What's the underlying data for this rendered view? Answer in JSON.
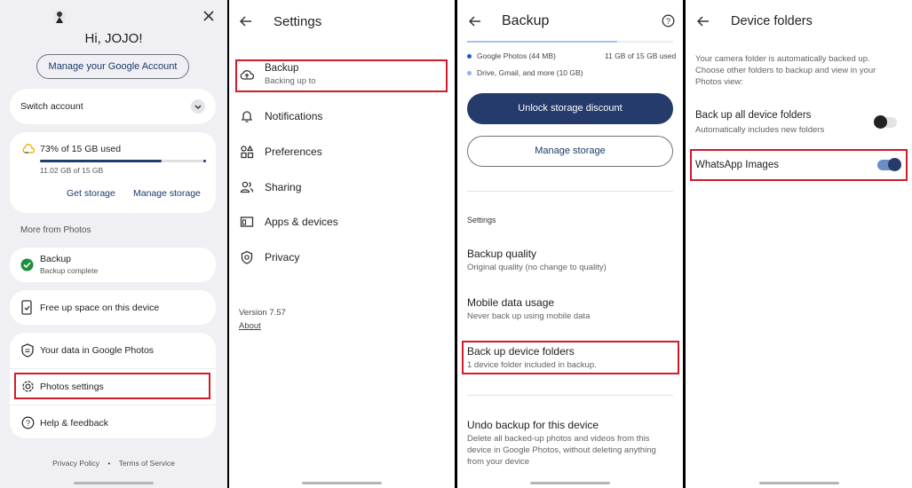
{
  "panel1": {
    "greeting": "Hi, JOJO!",
    "manage_account": "Manage your Google Account",
    "switch_account": "Switch account",
    "storage": {
      "used_text": "73% of 15 GB used",
      "detail": "11.02 GB of 15 GB",
      "percent": 73,
      "get_storage": "Get storage",
      "manage_storage": "Manage storage"
    },
    "more_from_photos": "More from Photos",
    "backup_title": "Backup",
    "backup_status": "Backup complete",
    "free_up": "Free up space on this device",
    "your_data": "Your data in Google Photos",
    "photos_settings": "Photos settings",
    "help": "Help & feedback",
    "privacy_policy": "Privacy Policy",
    "dot": "•",
    "terms": "Terms of Service"
  },
  "panel2": {
    "title": "Settings",
    "items": [
      {
        "label": "Backup",
        "sub": "Backing up to",
        "icon": "cloud-upload-icon"
      },
      {
        "label": "Notifications",
        "icon": "bell-icon"
      },
      {
        "label": "Preferences",
        "icon": "preferences-icon"
      },
      {
        "label": "Sharing",
        "icon": "people-icon"
      },
      {
        "label": "Apps & devices",
        "icon": "devices-icon"
      },
      {
        "label": "Privacy",
        "icon": "shield-icon"
      }
    ],
    "version": "Version 7.57",
    "about": "About"
  },
  "panel3": {
    "title": "Backup",
    "storage_bar_percent": 73,
    "legend1": "Google Photos (44 MB)",
    "legend1_color": "#1a57d6",
    "usage": "11 GB of 15 GB used",
    "legend2": "Drive, Gmail, and more (10 GB)",
    "legend2_color": "#8ab4f8",
    "unlock": "Unlock storage discount",
    "manage": "Manage storage",
    "settings_header": "Settings",
    "quality_title": "Backup quality",
    "quality_sub": "Original quality (no change to quality)",
    "mobile_title": "Mobile data usage",
    "mobile_sub": "Never back up using mobile data",
    "folders_title": "Back up device folders",
    "folders_sub": "1 device folder included in backup.",
    "undo_title": "Undo backup for this device",
    "undo_sub1": "Delete all backed-up photos and videos from this",
    "undo_sub2": "device in Google Photos, without deleting anything",
    "undo_sub3": "from your device"
  },
  "panel4": {
    "title": "Device folders",
    "desc1": "Your camera folder is automatically backed up.",
    "desc2": "Choose other folders to backup and view in your",
    "desc3": "Photos view:",
    "all_title": "Back up all device folders",
    "all_sub": "Automatically includes new folders",
    "all_on": false,
    "whatsapp": "WhatsApp Images",
    "whatsapp_on": true
  },
  "colors": {
    "accent_dark": "#243b6b",
    "red_highlight": "#d11a2a",
    "green_check": "#1e8e3e"
  }
}
